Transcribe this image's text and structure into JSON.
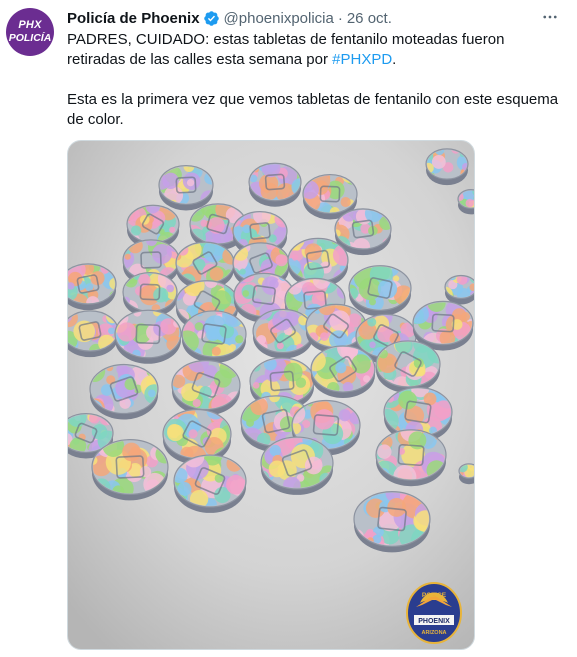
{
  "author": {
    "avatar_line1": "PHX",
    "avatar_line2": "POLICÍA",
    "name": "Policía de Phoenix",
    "handle": "@phoenixpolicia",
    "separator": "·",
    "date": "26 oct.",
    "verified_icon": "verified-badge-icon"
  },
  "more_menu_icon": "more-icon",
  "tweet": {
    "text1": "PADRES, CUIDADO: estas tabletas de fentanilo moteadas fueron retiradas de las calles esta semana por ",
    "hashtag": "#PHXPD",
    "text1_end": ".",
    "text2": "Esta es la primera vez que vemos tabletas de fentanilo con este esquema de color."
  },
  "media": {
    "badge_top": "POLICE",
    "badge_middle": "PHOENIX",
    "badge_bottom": "ARIZONA"
  },
  "colors": {
    "accent": "#1d9bf0",
    "avatar_bg": "#6b2d91",
    "badge_bg": "#2a3d8f",
    "badge_gold": "#e8b43a"
  }
}
